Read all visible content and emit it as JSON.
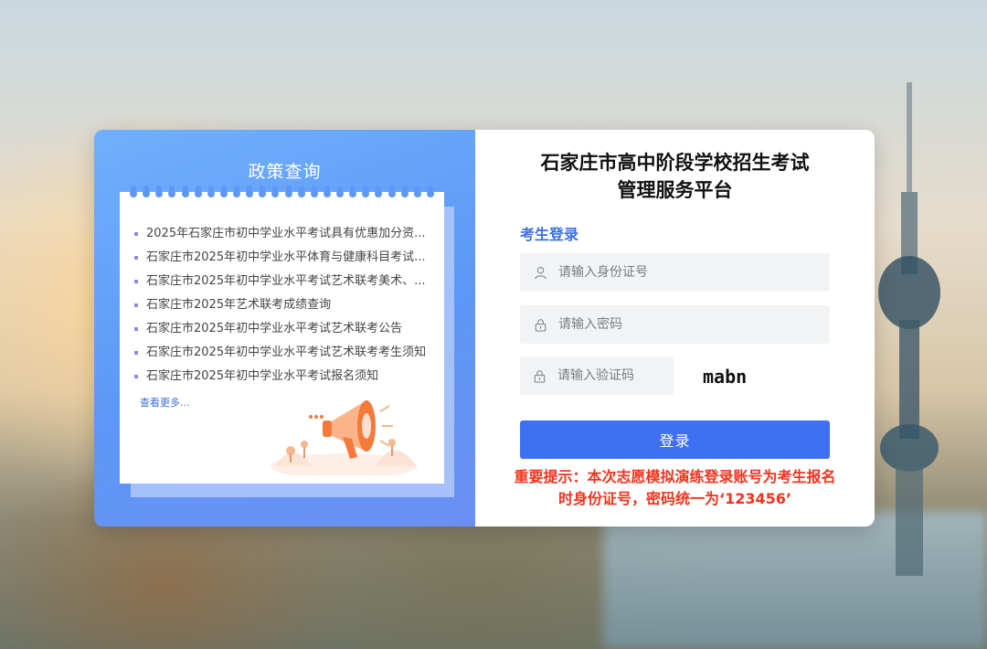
{
  "policy": {
    "title": "政策查询",
    "items": [
      "2025年石家庄市初中学业水平考试具有优惠加分资...",
      "石家庄市2025年初中学业水平体育与健康科目考试...",
      "石家庄市2025年初中学业水平考试艺术联考美术、...",
      "石家庄市2025年艺术联考成绩查询",
      "石家庄市2025年初中学业水平考试艺术联考公告",
      "石家庄市2025年初中学业水平考试艺术联考考生须知",
      "石家庄市2025年初中学业水平考试报名须知"
    ],
    "more": "查看更多..."
  },
  "login": {
    "title_line1": "石家庄市高中阶段学校招生考试",
    "title_line2": "管理服务平台",
    "label": "考生登录",
    "id_placeholder": "请输入身份证号",
    "password_placeholder": "请输入密码",
    "captcha_placeholder": "请输入验证码",
    "captcha_text": "mabn",
    "submit": "登录",
    "notice_line1": "重要提示：本次志愿模拟演练登录账号为考生报名",
    "notice_line2": "时身份证号，密码统一为‘123456’"
  },
  "icons": {
    "user": "user-icon",
    "lock": "lock-icon",
    "megaphone": "megaphone-icon"
  },
  "colors": {
    "primary": "#3f6ff2",
    "accent_text": "#3b6ee8",
    "notice": "#f2331d",
    "panel_blue": "#5d97f7"
  }
}
